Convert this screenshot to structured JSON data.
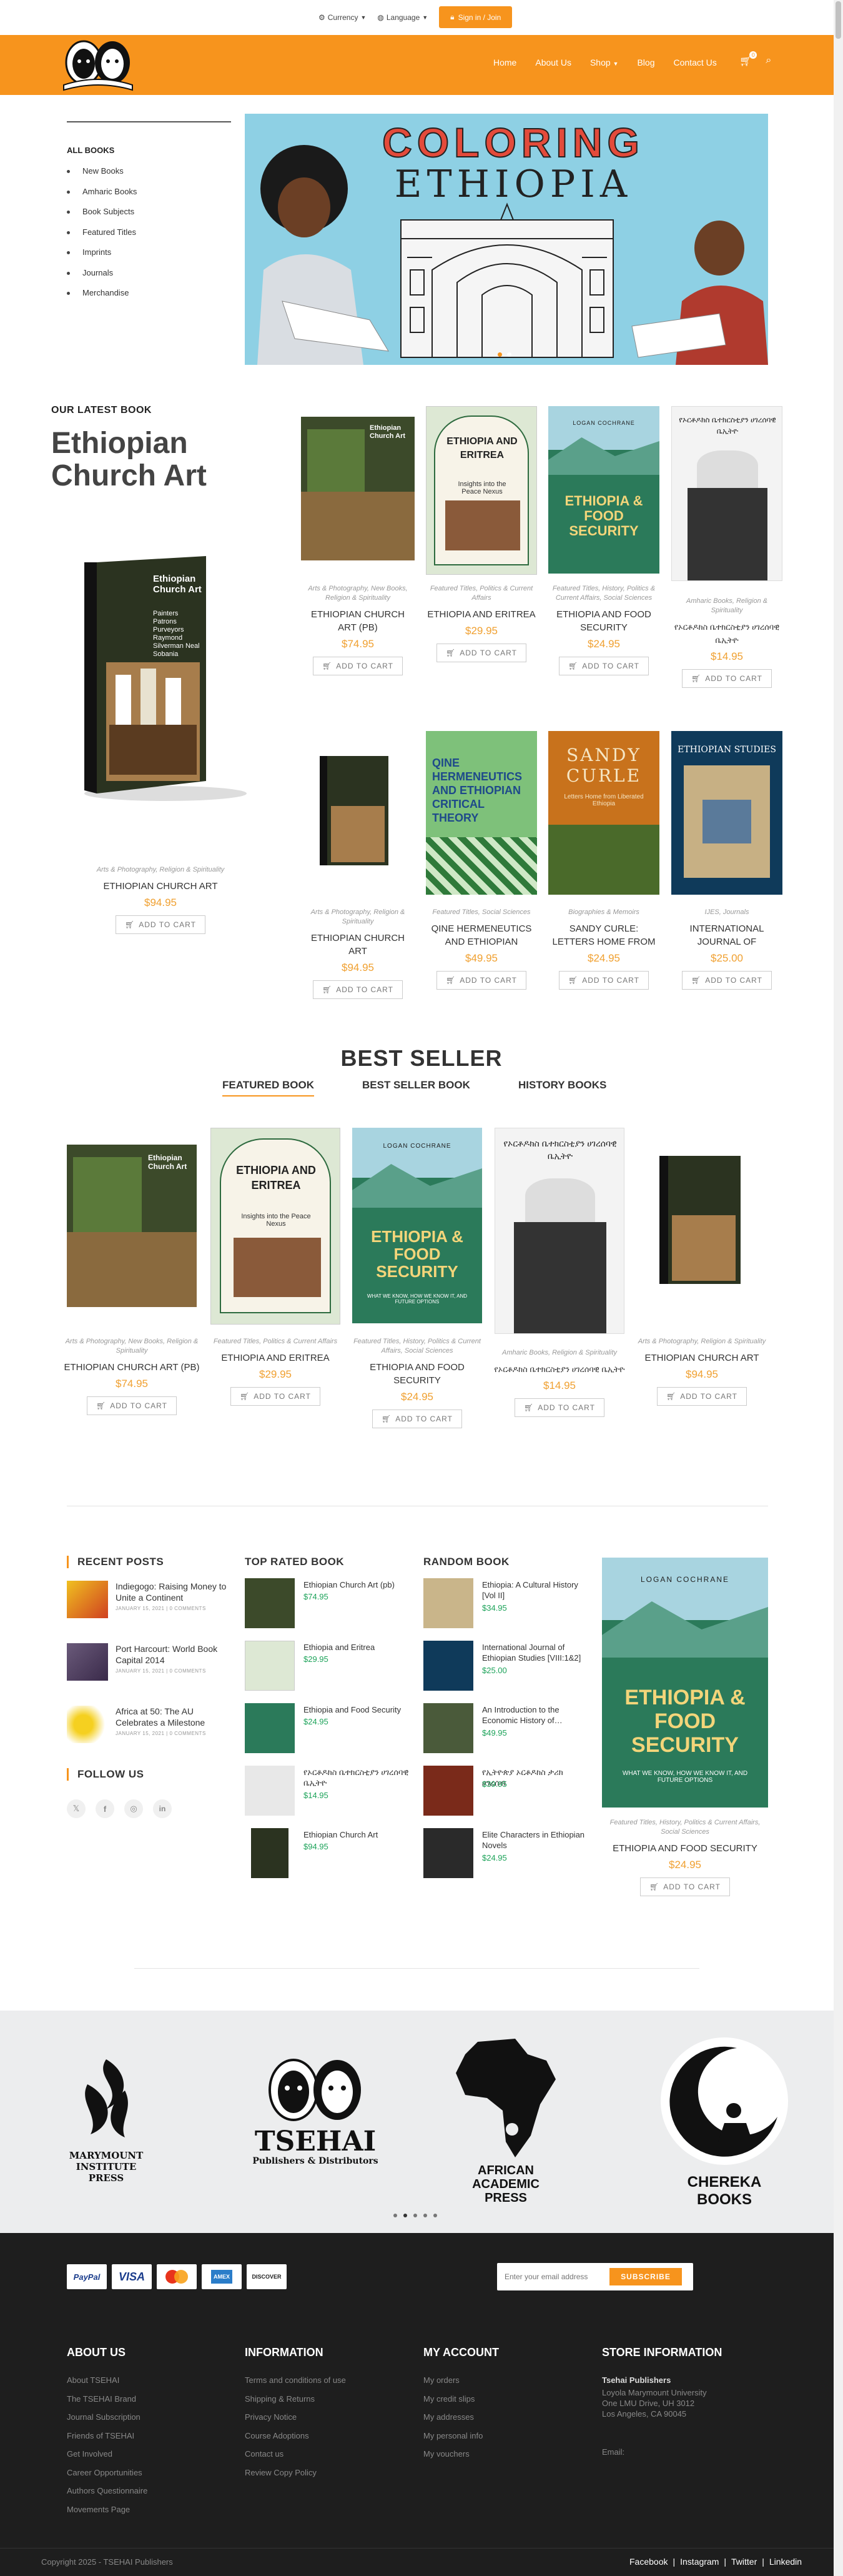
{
  "topbar": {
    "currency_label": "Currency",
    "language_label": "Language",
    "signin_label": "Sign in / Join"
  },
  "header": {
    "logo_alt": "TSEHAI",
    "nav": [
      "Home",
      "About Us",
      "Shop",
      "Blog",
      "Contact Us"
    ],
    "cart_count": "0"
  },
  "sidebar": {
    "title": "ALL BOOKS",
    "items": [
      "New Books",
      "Amharic Books",
      "Book Subjects",
      "Featured Titles",
      "Imprints",
      "Journals",
      "Merchandise"
    ]
  },
  "banner": {
    "title1": "COLORING",
    "title2": "ETHIOPIA"
  },
  "latest": {
    "label": "OUR LATEST BOOK",
    "title": "Ethiopian Church Art",
    "cover_title": "Ethiopian Church Art",
    "cover_sub": "Painters Patrons Purveyors Raymond Silverman Neal Sobania",
    "cat": "Arts & Photography, Religion & Spirituality",
    "name": "ETHIOPIAN CHURCH ART",
    "price": "$94.95"
  },
  "add_to_cart": "ADD TO CART",
  "grid": [
    {
      "cat": "Arts & Photography, New Books, Religion & Spirituality",
      "name": "ETHIOPIAN CHURCH ART (PB)",
      "price": "$74.95"
    },
    {
      "cat": "Featured Titles, Politics & Current Affairs",
      "name": "ETHIOPIA AND ERITREA",
      "price": "$29.95"
    },
    {
      "cat": "Featured Titles, History, Politics & Current Affairs, Social Sciences",
      "name": "ETHIOPIA AND FOOD SECURITY",
      "price": "$24.95"
    },
    {
      "cat": "Amharic Books, Religion & Spirituality",
      "name": "የኦርቶዶክስ ቤተክርስቲያን ሀገረሰባዊ ቤኢትዮ",
      "price": "$14.95"
    },
    {
      "cat": "Arts & Photography, Religion & Spirituality",
      "name": "ETHIOPIAN CHURCH ART",
      "price": "$94.95"
    },
    {
      "cat": "Featured Titles, Social Sciences",
      "name": "QINE HERMENEUTICS AND ETHIOPIAN",
      "price": "$49.95"
    },
    {
      "cat": "Biographies & Memoirs",
      "name": "SANDY CURLE: LETTERS HOME FROM",
      "price": "$24.95"
    },
    {
      "cat": "IJES, Journals",
      "name": "INTERNATIONAL JOURNAL OF",
      "price": "$25.00"
    }
  ],
  "covers": {
    "eritrea": "ETHIOPIA AND ERITREA",
    "eritrea_sub": "Insights into the Peace Nexus",
    "food_author": "LOGAN COCHRANE",
    "food_title": "ETHIOPIA & FOOD SECURITY",
    "food_sub": "WHAT WE KNOW, HOW WE KNOW IT, AND FUTURE OPTIONS",
    "amharic": "የኦርቶዶክስ ቤተክርስቲያን ሀገረሰባዊ ቤኢትዮ",
    "qine": "QINE HERMENEUTICS AND ETHIOPIAN CRITICAL THEORY",
    "sandy": "SANDY CURLE",
    "sandy_sub": "Letters Home from Liberated Ethiopia",
    "ijes": "ETHIOPIAN STUDIES"
  },
  "bestseller": {
    "title": "BEST SELLER",
    "tabs": [
      "FEATURED BOOK",
      "BEST SELLER BOOK",
      "HISTORY BOOKS"
    ],
    "items": [
      {
        "cat": "Arts & Photography, New Books, Religion & Spirituality",
        "name": "ETHIOPIAN CHURCH ART (PB)",
        "price": "$74.95"
      },
      {
        "cat": "Featured Titles, Politics & Current Affairs",
        "name": "ETHIOPIA AND ERITREA",
        "price": "$29.95"
      },
      {
        "cat": "Featured Titles, History, Politics & Current Affairs, Social Sciences",
        "name": "ETHIOPIA AND FOOD SECURITY",
        "price": "$24.95"
      },
      {
        "cat": "Amharic Books, Religion & Spirituality",
        "name": "የኦርቶዶክስ ቤተክርስቲያን ሀገረሰባዊ ቤኢትዮ",
        "price": "$14.95"
      },
      {
        "cat": "Arts & Photography, Religion & Spirituality",
        "name": "ETHIOPIAN CHURCH ART",
        "price": "$94.95"
      }
    ]
  },
  "recent": {
    "title": "RECENT POSTS",
    "posts": [
      {
        "title": "Indiegogo: Raising Money to Unite a Continent",
        "meta": "JANUARY 15, 2021 | 0 COMMENTS"
      },
      {
        "title": "Port Harcourt: World Book Capital 2014",
        "meta": "JANUARY 15, 2021 | 0 COMMENTS"
      },
      {
        "title": "Africa at 50: The AU Celebrates a Milestone",
        "meta": "JANUARY 15, 2021 | 0 COMMENTS"
      }
    ],
    "follow": "FOLLOW US"
  },
  "toprated": {
    "title": "TOP RATED BOOK",
    "items": [
      {
        "name": "Ethiopian Church Art (pb)",
        "price": "$74.95"
      },
      {
        "name": "Ethiopia and Eritrea",
        "price": "$29.95"
      },
      {
        "name": "Ethiopia and Food Security",
        "price": "$24.95"
      },
      {
        "name": "የኦርቶዶክስ ቤተክርስቲያን ሀገረሰባዊ ቤኢትዮ",
        "price": "$14.95"
      },
      {
        "name": "Ethiopian Church Art",
        "price": "$94.95"
      }
    ]
  },
  "random": {
    "title": "RANDOM BOOK",
    "items": [
      {
        "name": "Ethiopia: A Cultural History [Vol II]",
        "price": "$34.95"
      },
      {
        "name": "International Journal of Ethiopian Studies [VIII:1&2]",
        "price": "$25.00"
      },
      {
        "name": "An Introduction to the Economic History of…",
        "price": "$49.95"
      },
      {
        "name": "የኢትዮጵያ ኦርቶዶክስ ታሪክ ሀገረሰብ",
        "price": "$39.95"
      },
      {
        "name": "Elite Characters in Ethiopian Novels",
        "price": "$24.95"
      }
    ]
  },
  "side_feature": {
    "cat": "Featured Titles, History, Politics & Current Affairs, Social Sciences",
    "name": "ETHIOPIA AND FOOD SECURITY",
    "price": "$24.95"
  },
  "partners": {
    "marymount": "MARYMOUNT INSTITUTE PRESS",
    "tsehai": "TSEHAI",
    "tsehai_sub": "Publishers & Distributors",
    "aap": "AFRICAN ACADEMIC PRESS",
    "chereka": "CHEREKA BOOKS"
  },
  "footer": {
    "payments": [
      "PayPal",
      "VISA",
      "MC",
      "AMEX",
      "DISCOVER"
    ],
    "email_placeholder": "Enter your email address",
    "subscribe": "SUBSCRIBE",
    "about": {
      "title": "ABOUT US",
      "links": [
        "About TSEHAI",
        "The TSEHAI Brand",
        "Journal Subscription",
        "Friends of TSEHAI",
        "Get Involved",
        "Career Opportunities",
        "Authors Questionnaire",
        "Movements Page"
      ]
    },
    "info": {
      "title": "INFORMATION",
      "links": [
        "Terms and conditions of use",
        "Shipping & Returns",
        "Privacy Notice",
        "Course Adoptions",
        "Contact us",
        "Review Copy Policy"
      ]
    },
    "account": {
      "title": "MY ACCOUNT",
      "links": [
        "My orders",
        "My credit slips",
        "My addresses",
        "My personal info",
        "My vouchers"
      ]
    },
    "store": {
      "title": "STORE INFORMATION",
      "name": "Tsehai Publishers",
      "lines": [
        "Loyola Marymount University",
        "One LMU Drive, UH 3012",
        "Los Angeles, CA 90045"
      ],
      "email": "Email:"
    },
    "copyright": "Copyright 2025 - TSEHAI Publishers",
    "social": [
      "Facebook",
      "Instagram",
      "Twitter",
      "Linkedin"
    ]
  },
  "colors": {
    "accent": "#f7941d",
    "price": "#f0a030",
    "green_price": "#1da35a",
    "footer_bg": "#1e1e1e"
  }
}
